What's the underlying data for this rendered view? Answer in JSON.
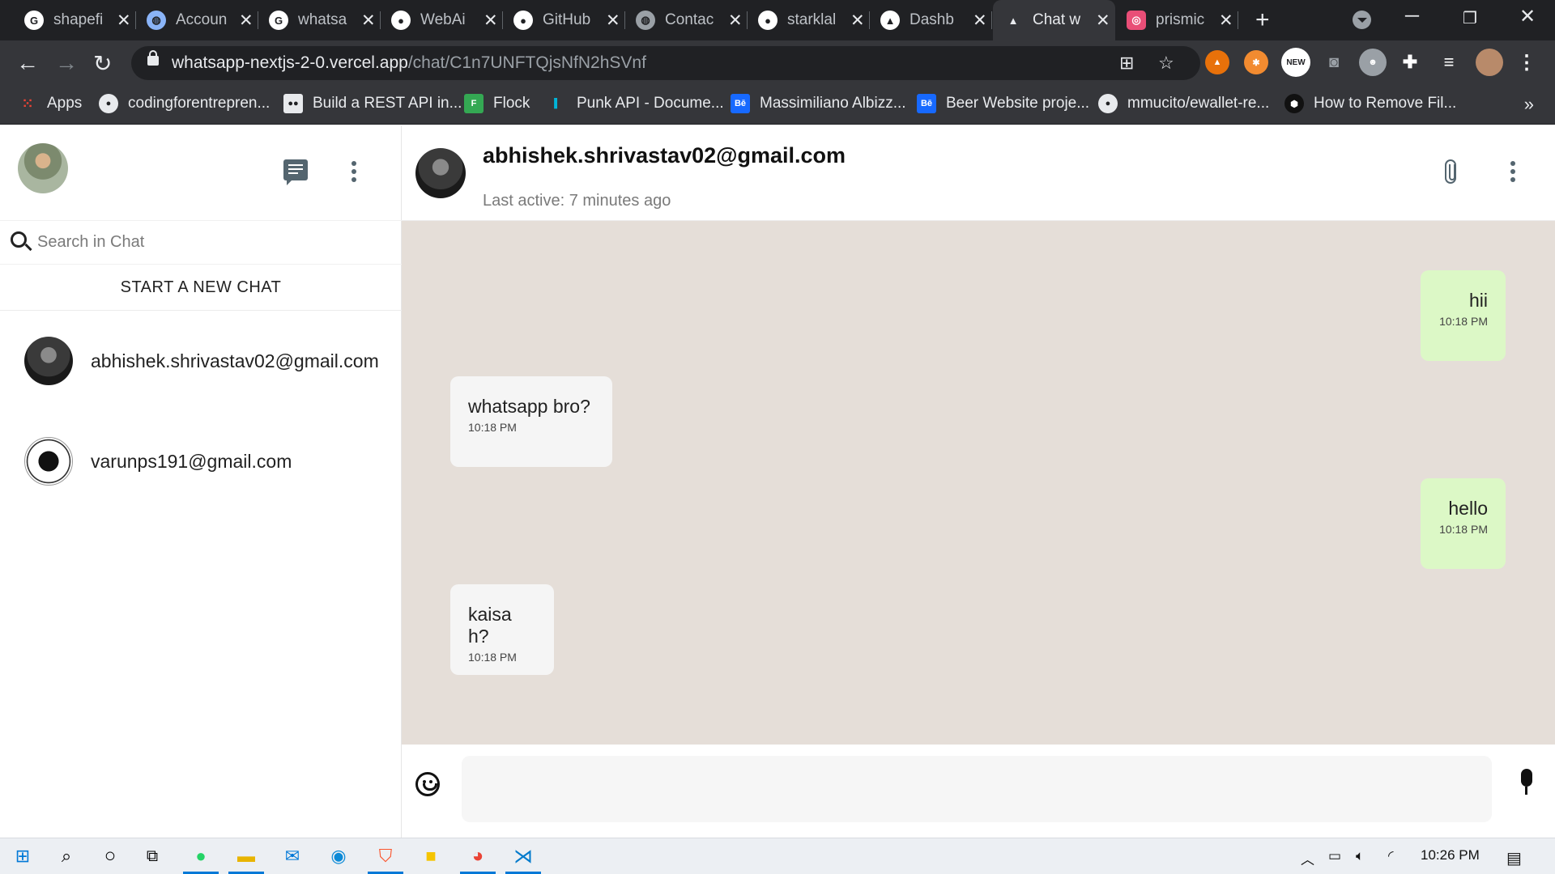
{
  "browser": {
    "tabs": [
      {
        "title": "shapefi",
        "favicon": "google-icon",
        "color": "#ffffff"
      },
      {
        "title": "Accoun",
        "favicon": "globe-icon",
        "color": "#8ab4f8"
      },
      {
        "title": "whatsa",
        "favicon": "google-icon",
        "color": "#ffffff"
      },
      {
        "title": "WebAi",
        "favicon": "github-icon",
        "color": "#ffffff"
      },
      {
        "title": "GitHub",
        "favicon": "github-icon",
        "color": "#ffffff"
      },
      {
        "title": "Contac",
        "favicon": "globe-icon",
        "color": "#9aa0a6"
      },
      {
        "title": "starklal",
        "favicon": "github-icon",
        "color": "#ffffff"
      },
      {
        "title": "Dashb",
        "favicon": "vercel-icon",
        "color": "#ffffff"
      },
      {
        "title": "Chat w",
        "favicon": "vercel-icon",
        "color": "#202124",
        "active": true
      },
      {
        "title": "prismic",
        "favicon": "prismic-icon",
        "color": "#e94e77"
      }
    ],
    "url_host": "whatsapp-nextjs-2-0.vercel.app",
    "url_path": "/chat/C1n7UNFTQjsNfN2hSVnf",
    "bookmarks": [
      {
        "label": "Apps",
        "icon": "apps-grid-icon"
      },
      {
        "label": "codingforentrepren...",
        "icon": "github-icon"
      },
      {
        "label": "Build a REST API in...",
        "icon": "medium-icon"
      },
      {
        "label": "Flock",
        "icon": "flock-icon"
      },
      {
        "label": "Punk API - Docume...",
        "icon": "punk-api-icon"
      },
      {
        "label": "Massimiliano Albizz...",
        "icon": "behance-icon"
      },
      {
        "label": "Beer Website proje...",
        "icon": "behance-icon"
      },
      {
        "label": "mmucito/ewallet-re...",
        "icon": "github-icon"
      },
      {
        "label": "How to Remove Fil...",
        "icon": "hexagon-icon"
      }
    ],
    "bookmarks_more": "»",
    "extension_badge": "NEW"
  },
  "sidebar": {
    "search_placeholder": "Search in Chat",
    "new_chat_label": "START A NEW CHAT",
    "contacts": [
      {
        "email": "abhishek.shrivastav02@gmail.com"
      },
      {
        "email": "varunps191@gmail.com"
      }
    ]
  },
  "chat": {
    "recipient": "abhishek.shrivastav02@gmail.com",
    "last_active": "Last active: 7 minutes ago",
    "messages": [
      {
        "text": "hii",
        "time": "10:18 PM",
        "direction": "sent"
      },
      {
        "text": "whatsapp bro?",
        "time": "10:18 PM",
        "direction": "received"
      },
      {
        "text": "hello",
        "time": "10:18 PM",
        "direction": "sent"
      },
      {
        "text": "kaisa h?",
        "time": "10:18 PM",
        "direction": "received"
      }
    ],
    "input_value": ""
  },
  "taskbar": {
    "clock": "10:26 PM",
    "apps": [
      "windows-start-icon",
      "search-icon",
      "cortana-icon",
      "task-view-icon",
      "whatsapp-icon",
      "file-explorer-icon",
      "mail-icon",
      "edge-icon",
      "brave-icon",
      "sticky-notes-icon",
      "chrome-icon",
      "vscode-icon"
    ]
  },
  "colors": {
    "chat_background": "#e5ded8",
    "sent_bubble": "#dcf8c6",
    "received_bubble": "#f5f5f5"
  }
}
